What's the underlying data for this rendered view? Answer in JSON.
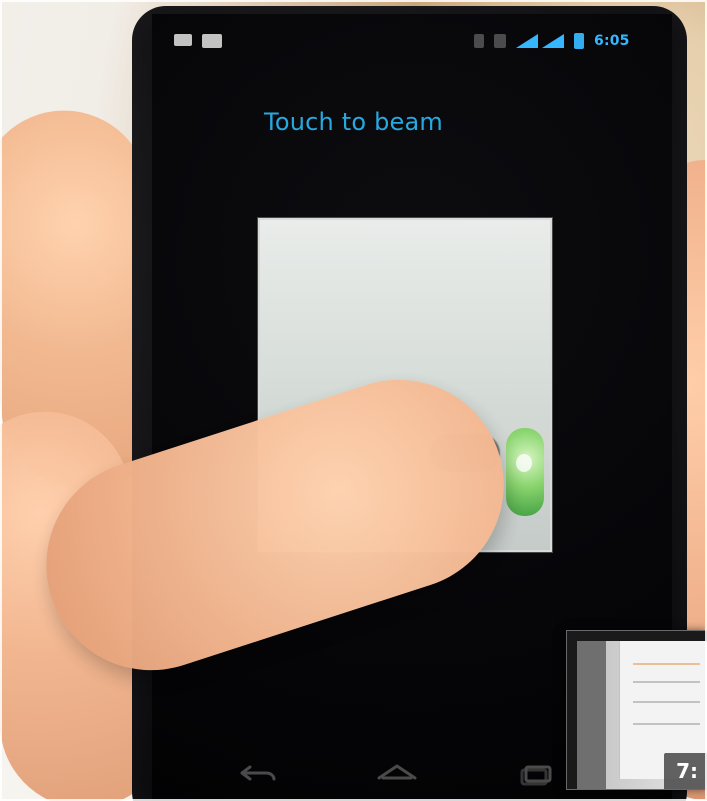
{
  "status_bar": {
    "time": "6:05"
  },
  "screen": {
    "title": "Touch to beam"
  },
  "video_thumbnail": {
    "timestamp": "7:"
  },
  "icons": {
    "status_left": [
      "photo-icon",
      "video-icon"
    ],
    "status_right": [
      "sync-icon",
      "sd-icon",
      "wifi-icon",
      "signal-icon",
      "battery-icon"
    ],
    "nav": [
      "back-icon",
      "home-icon",
      "recents-icon"
    ]
  },
  "colors": {
    "accent": "#27a8df",
    "status_accent": "#36b7ff"
  }
}
